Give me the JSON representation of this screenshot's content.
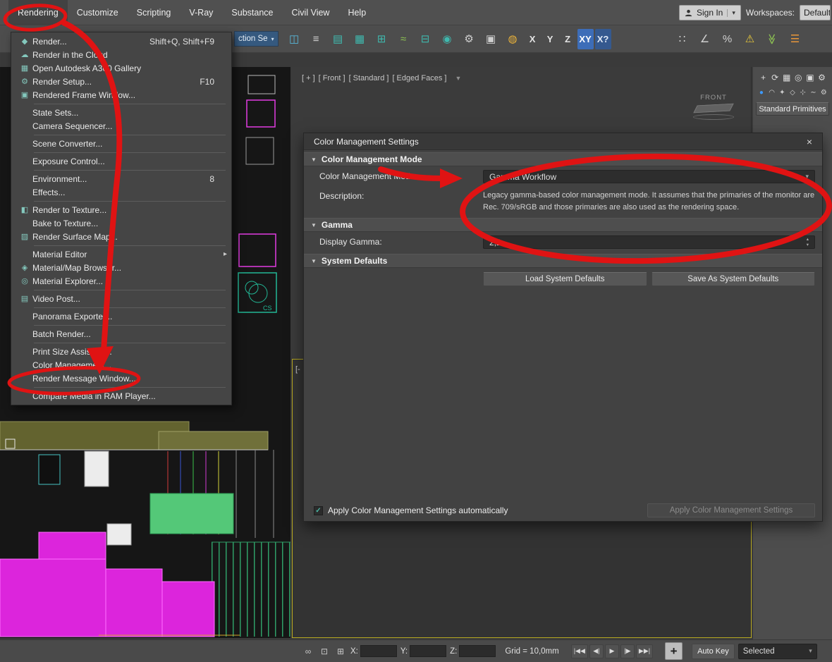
{
  "glyphs": {
    "chev_down": "▾",
    "chev_up": "▴",
    "tri_right": "▸",
    "tri_down": "▼",
    "close": "×",
    "check": "✓",
    "plus": "+",
    "funnel": "▼"
  },
  "menubar": {
    "items": [
      {
        "label": "Rendering",
        "selected": true
      },
      {
        "label": "Customize"
      },
      {
        "label": "Scripting"
      },
      {
        "label": "V-Ray"
      },
      {
        "label": "Substance"
      },
      {
        "label": "Civil View"
      },
      {
        "label": "Help"
      }
    ],
    "sign_in_label": "Sign In",
    "workspaces_label": "Workspaces:",
    "workspaces_value": "Default"
  },
  "toolbar": {
    "selection_set_value": "ction Se",
    "icons": [
      {
        "name": "mirror-icon",
        "glyph": "◫",
        "color": "#58b6d8"
      },
      {
        "name": "align-icon",
        "glyph": "≡",
        "color": "#cfcfcf"
      },
      {
        "name": "toggle-scene-explorer-icon",
        "glyph": "▤",
        "color": "#3fb8ae"
      },
      {
        "name": "layer-explorer-icon",
        "glyph": "▦",
        "color": "#3fb8ae"
      },
      {
        "name": "ribbon-icon",
        "glyph": "⊞",
        "color": "#3fb8ae"
      },
      {
        "name": "curve-editor-icon",
        "glyph": "≈",
        "color": "#8cc152"
      },
      {
        "name": "schematic-view-icon",
        "glyph": "⊟",
        "color": "#3fb8ae"
      },
      {
        "name": "material-editor-icon",
        "glyph": "◉",
        "color": "#3fb8ae"
      },
      {
        "name": "render-setup-icon",
        "glyph": "⚙",
        "color": "#cfcfcf"
      },
      {
        "name": "rendered-frame-window-icon",
        "glyph": "▣",
        "color": "#cfcfcf"
      },
      {
        "name": "render-production-icon",
        "glyph": "◍",
        "color": "#e8b13a"
      },
      {
        "name": "axis-x-button",
        "glyph": "X",
        "color": "#e4e4e4",
        "text": true
      },
      {
        "name": "axis-y-button",
        "glyph": "Y",
        "color": "#e4e4e4",
        "text": true
      },
      {
        "name": "axis-z-button",
        "glyph": "Z",
        "color": "#e4e4e4",
        "text": true
      },
      {
        "name": "axis-xy-button",
        "glyph": "XY",
        "color": "#ffffff",
        "bg": "#3d6db8",
        "text": true
      },
      {
        "name": "axis-xy-flyout-button",
        "glyph": "X?",
        "color": "#dfe8f5",
        "bg": "#35598f",
        "text": true
      }
    ],
    "right_icons": [
      {
        "name": "snaps-toggle-icon",
        "glyph": "∷",
        "color": "#cfcfcf"
      },
      {
        "name": "angle-snap-icon",
        "glyph": "∠",
        "color": "#cfcfcf"
      },
      {
        "name": "percent-snap-icon",
        "glyph": "%",
        "color": "#cfcfcf"
      },
      {
        "name": "warning-icon",
        "glyph": "⚠",
        "color": "#e8c83a"
      },
      {
        "name": "import-state-icon",
        "glyph": "≫",
        "color": "#8cc152",
        "rot": true
      },
      {
        "name": "main-menu-icon",
        "glyph": "☰",
        "color": "#e8963a"
      }
    ]
  },
  "rendering_menu": {
    "items": [
      {
        "icon_glyph": "◆",
        "label": "Render...",
        "shortcut": "Shift+Q, Shift+F9"
      },
      {
        "icon_glyph": "☁",
        "label": "Render in the Cloud",
        "shortcut": ""
      },
      {
        "icon_glyph": "▦",
        "label": "Open Autodesk A360 Gallery",
        "shortcut": ""
      },
      {
        "icon_glyph": "⚙",
        "label": "Render Setup...",
        "shortcut": "F10"
      },
      {
        "icon_glyph": "▣",
        "label": "Rendered Frame Window...",
        "shortcut": ""
      },
      {
        "separator": true
      },
      {
        "icon_glyph": "",
        "label": "State Sets...",
        "shortcut": ""
      },
      {
        "icon_glyph": "",
        "label": "Camera Sequencer...",
        "shortcut": ""
      },
      {
        "separator": true
      },
      {
        "icon_glyph": "",
        "label": "Scene Converter...",
        "shortcut": ""
      },
      {
        "separator": true
      },
      {
        "icon_glyph": "",
        "label": "Exposure Control...",
        "shortcut": ""
      },
      {
        "separator": true
      },
      {
        "icon_glyph": "",
        "label": "Environment...",
        "shortcut": "8"
      },
      {
        "icon_glyph": "",
        "label": "Effects...",
        "shortcut": ""
      },
      {
        "separator": true
      },
      {
        "icon_glyph": "◧",
        "label": "Render to Texture...",
        "shortcut": ""
      },
      {
        "icon_glyph": "",
        "label": "Bake to Texture...",
        "shortcut": ""
      },
      {
        "icon_glyph": "▨",
        "label": "Render Surface Map...",
        "shortcut": ""
      },
      {
        "separator": true
      },
      {
        "icon_glyph": "",
        "label": "Material Editor",
        "shortcut": "",
        "submenu": true
      },
      {
        "icon_glyph": "◈",
        "label": "Material/Map Browser...",
        "shortcut": ""
      },
      {
        "icon_glyph": "◎",
        "label": "Material Explorer...",
        "shortcut": ""
      },
      {
        "separator": true
      },
      {
        "icon_glyph": "▤",
        "label": "Video Post...",
        "shortcut": ""
      },
      {
        "separator": true
      },
      {
        "icon_glyph": "",
        "label": "Panorama Exporter...",
        "shortcut": ""
      },
      {
        "separator": true
      },
      {
        "icon_glyph": "",
        "label": "Batch Render...",
        "shortcut": ""
      },
      {
        "separator": true
      },
      {
        "icon_glyph": "",
        "label": "Print Size Assistant...",
        "shortcut": ""
      },
      {
        "icon_glyph": "",
        "label": "Color Management...",
        "shortcut": ""
      },
      {
        "icon_glyph": "",
        "label": "Render Message Window...",
        "shortcut": ""
      },
      {
        "separator": true
      },
      {
        "icon_glyph": "",
        "label": "Compare Media in RAM Player...",
        "shortcut": ""
      }
    ]
  },
  "dialog": {
    "title": "Color Management Settings",
    "mode_section": {
      "title": "Color Management Mode",
      "mode_label": "Color Management Mode:",
      "mode_value": "Gamma Workflow",
      "desc_label": "Description:",
      "desc_text": "Legacy gamma-based color management mode. It assumes that the primaries of the monitor are Rec. 709/sRGB and those primaries are also used as the rendering space."
    },
    "gamma_section": {
      "title": "Gamma",
      "display_gamma_label": "Display Gamma:",
      "display_gamma_value": "2,2"
    },
    "defaults_section": {
      "title": "System Defaults",
      "load_button": "Load System Defaults",
      "save_button": "Save As System Defaults"
    },
    "footer": {
      "auto_apply_label": "Apply Color Management Settings automatically",
      "auto_apply_checked": true,
      "apply_button": "Apply Color Management Settings"
    }
  },
  "front_viewport": {
    "label_segments": [
      "[ + ]",
      "[ Front ]",
      "[ Standard ]",
      "[ Edged Faces ]"
    ],
    "viewcube_label": "FRONT"
  },
  "persp_viewport": {
    "label": "[-"
  },
  "right_panel": {
    "tabs": [
      {
        "name": "tab-create",
        "glyph": "+",
        "selected": true
      },
      {
        "name": "tab-modify",
        "glyph": "⟳"
      },
      {
        "name": "tab-hierarchy",
        "glyph": "▦"
      },
      {
        "name": "tab-motion",
        "glyph": "◎"
      },
      {
        "name": "tab-display",
        "glyph": "▣"
      },
      {
        "name": "tab-utilities",
        "glyph": "⚙"
      }
    ],
    "categories": [
      {
        "name": "category-geometry",
        "glyph": "●",
        "color": "#3d9aff",
        "selected": true
      },
      {
        "name": "category-shapes",
        "glyph": "◠"
      },
      {
        "name": "category-lights",
        "glyph": "✦"
      },
      {
        "name": "category-cameras",
        "glyph": "◇"
      },
      {
        "name": "category-helpers",
        "glyph": "⊹"
      },
      {
        "name": "category-spacewarps",
        "glyph": "∼"
      },
      {
        "name": "category-systems",
        "glyph": "⚙"
      }
    ],
    "dropdown_value": "Standard Primitives"
  },
  "statusbar": {
    "x_label": "X:",
    "y_label": "Y:",
    "z_label": "Z:",
    "grid_text": "Grid = 10,0mm",
    "transport": [
      {
        "name": "go-start-button",
        "glyph": "|◀◀"
      },
      {
        "name": "prev-frame-button",
        "glyph": "◀|"
      },
      {
        "name": "play-button",
        "glyph": "▶"
      },
      {
        "name": "next-frame-button",
        "glyph": "|▶"
      },
      {
        "name": "go-end-button",
        "glyph": "▶▶|"
      }
    ],
    "auto_key_label": "Auto Key",
    "selected_value": "Selected",
    "plus_glyph": "+"
  }
}
